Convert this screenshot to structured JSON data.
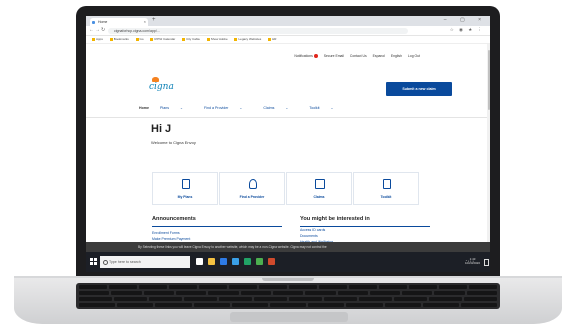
{
  "browser": {
    "tab_title": "Home",
    "url": "cignaforhcp.cigna.com/app/...",
    "bookmarks": [
      "Apps",
      "Bookmarks",
      "Go",
      "RPNJ Calendar",
      "City Cable",
      "Show Adobe",
      "Legacy Websites",
      "HR"
    ]
  },
  "header": {
    "notifications_label": "Notifications",
    "links": [
      "Secure Email",
      "Contact Us",
      "Espanol",
      "English",
      "Log Out"
    ],
    "logo_text": "cigna",
    "submit_button": "Submit a new claim"
  },
  "main_nav": [
    "Home",
    "Plans",
    "Find a Provider",
    "Claims",
    "Toolkit"
  ],
  "greeting": "Hi J",
  "welcome": "Welcome to Cigna Envoy",
  "cards": [
    {
      "label": "My Plans",
      "icon": "document-icon"
    },
    {
      "label": "Find a Provider",
      "icon": "person-icon"
    },
    {
      "label": "Claims",
      "icon": "wallet-icon"
    },
    {
      "label": "Toolkit",
      "icon": "clipboard-icon"
    }
  ],
  "announcements": {
    "title": "Announcements",
    "items": [
      "Enrollment Forms",
      "Make Premium Payment"
    ]
  },
  "interests": {
    "title": "You might be interested in",
    "items": [
      "Access ID cards",
      "Documents",
      "Health and Wellbeing"
    ]
  },
  "banner_text": "By Selecting these links you will leave Cigna Envoy to another website, which may be a non-Cigna website. Cigna may not control the",
  "taskbar": {
    "search_placeholder": "Type here to search",
    "clock_time": "1:43",
    "clock_date": "10/23/2020"
  },
  "colors": {
    "brand_blue": "#0a4a9c",
    "accent_orange": "#f58220",
    "logo_teal": "#0a7fb5"
  }
}
